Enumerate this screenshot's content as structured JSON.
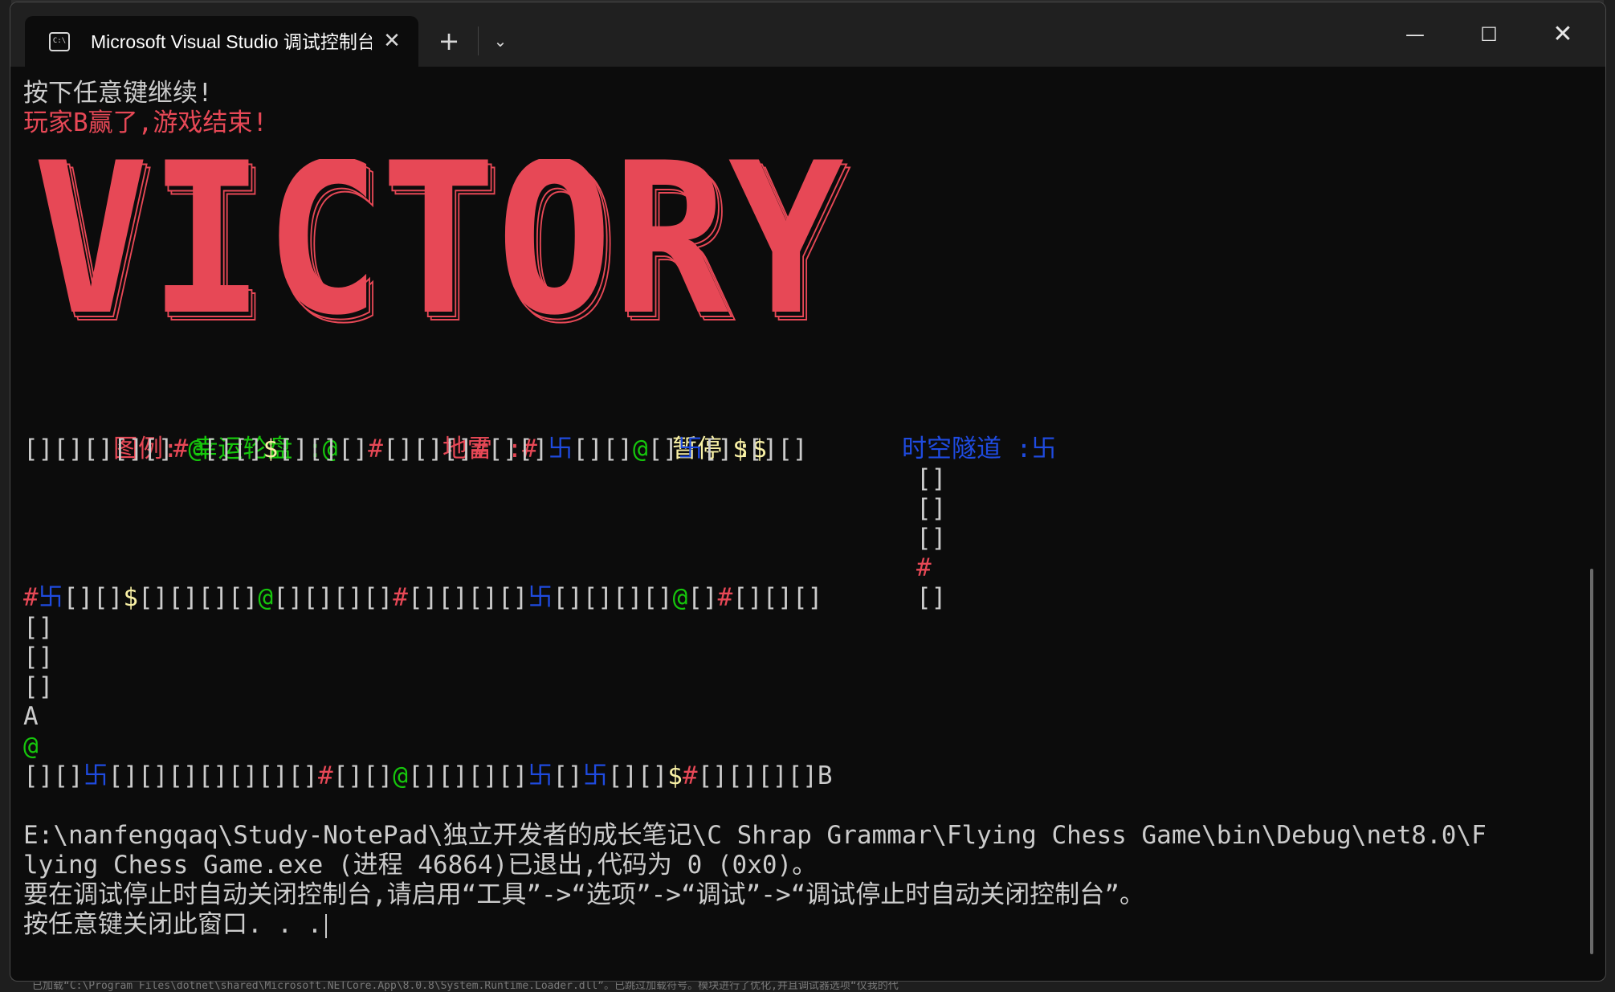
{
  "window": {
    "tab_title": "Microsoft Visual Studio 调试控制台",
    "tab_icon": "console-icon",
    "close_tab_symbol": "✕",
    "new_tab_symbol": "+",
    "dropdown_symbol": "⌄",
    "minimize_symbol": "—",
    "maximize_symbol": "☐",
    "close_symbol": "✕"
  },
  "colors": {
    "background": "#0c0c0c",
    "text": "#cccccc",
    "red": "#e74856",
    "green": "#16c60c",
    "yellow": "#f9f1a5",
    "blue": "#1f4be0"
  },
  "console": {
    "line1": "按下任意键继续!",
    "line2": "玩家B赢了,游戏结束!",
    "banner": "VICTORY",
    "legend": {
      "label": "图例:",
      "lucky": "幸运轮盘 :@",
      "mine": "地雷 :#",
      "pause": "暂停 :$",
      "tunnel": "时空隧道 :卐"
    },
    "board": {
      "row_top": [
        {
          "t": "[][][][][]",
          "c": "w"
        },
        {
          "t": "#",
          "c": "r"
        },
        {
          "t": "@",
          "c": "g"
        },
        {
          "t": "[][]",
          "c": "w"
        },
        {
          "t": "$",
          "c": "y"
        },
        {
          "t": "[][][]",
          "c": "w"
        },
        {
          "t": "#",
          "c": "r"
        },
        {
          "t": "[][][]",
          "c": "w"
        },
        {
          "t": "#",
          "c": "r"
        },
        {
          "t": "[][]",
          "c": "w"
        },
        {
          "t": "卐",
          "c": "b"
        },
        {
          "t": "[][]",
          "c": "w"
        },
        {
          "t": "@",
          "c": "g"
        },
        {
          "t": "[]",
          "c": "w"
        },
        {
          "t": "卐",
          "c": "b"
        },
        {
          "t": "[]",
          "c": "w"
        },
        {
          "t": "$",
          "c": "y"
        },
        {
          "t": "[][]",
          "c": "w"
        }
      ],
      "right_column": [
        {
          "t": "[]",
          "c": "w"
        },
        {
          "t": "[]",
          "c": "w"
        },
        {
          "t": "[]",
          "c": "w"
        },
        {
          "t": "#",
          "c": "r"
        },
        {
          "t": "[]",
          "c": "w"
        }
      ],
      "row_middle": [
        {
          "t": "#",
          "c": "r"
        },
        {
          "t": "卐",
          "c": "b"
        },
        {
          "t": "[][]",
          "c": "w"
        },
        {
          "t": "$",
          "c": "y"
        },
        {
          "t": "[][][][]",
          "c": "w"
        },
        {
          "t": "@",
          "c": "g"
        },
        {
          "t": "[][][][]",
          "c": "w"
        },
        {
          "t": "#",
          "c": "r"
        },
        {
          "t": "[][][][]",
          "c": "w"
        },
        {
          "t": "卐",
          "c": "b"
        },
        {
          "t": "[][][][]",
          "c": "w"
        },
        {
          "t": "@",
          "c": "g"
        },
        {
          "t": "[]",
          "c": "w"
        },
        {
          "t": "#",
          "c": "r"
        },
        {
          "t": "[][][]",
          "c": "w"
        }
      ],
      "left_column": [
        {
          "t": "[]",
          "c": "w"
        },
        {
          "t": "[]",
          "c": "w"
        },
        {
          "t": "[]",
          "c": "w"
        },
        {
          "t": "A",
          "c": "w"
        },
        {
          "t": "@",
          "c": "g"
        }
      ],
      "row_bottom": [
        {
          "t": "[][]",
          "c": "w"
        },
        {
          "t": "卐",
          "c": "b"
        },
        {
          "t": "[][][][][][][]",
          "c": "w"
        },
        {
          "t": "#",
          "c": "r"
        },
        {
          "t": "[][]",
          "c": "w"
        },
        {
          "t": "@",
          "c": "g"
        },
        {
          "t": "[][][][]",
          "c": "w"
        },
        {
          "t": "卐",
          "c": "b"
        },
        {
          "t": "[]",
          "c": "w"
        },
        {
          "t": "卐",
          "c": "b"
        },
        {
          "t": "[][]",
          "c": "w"
        },
        {
          "t": "$",
          "c": "y"
        },
        {
          "t": "#",
          "c": "r"
        },
        {
          "t": "[][][][]B",
          "c": "w"
        }
      ]
    },
    "exit_line1": "E:\\nanfengqaq\\Study-NotePad\\独立开发者的成长笔记\\C Shrap Grammar\\Flying Chess Game\\bin\\Debug\\net8.0\\F",
    "exit_line2": "lying Chess Game.exe (进程 46864)已退出,代码为 0 (0x0)。",
    "exit_line3": "要在调试停止时自动关闭控制台,请启用“工具”->“选项”->“调试”->“调试停止时自动关闭控制台”。",
    "exit_line4": "按任意键关闭此窗口. . ."
  },
  "background_strip": "已加载“C:\\Program Files\\dotnet\\shared\\Microsoft.NETCore.App\\8.0.8\\System.Runtime.Loader.dll”。已跳过加载符号。模块进行了优化,并且调试器选项“仅我的代"
}
